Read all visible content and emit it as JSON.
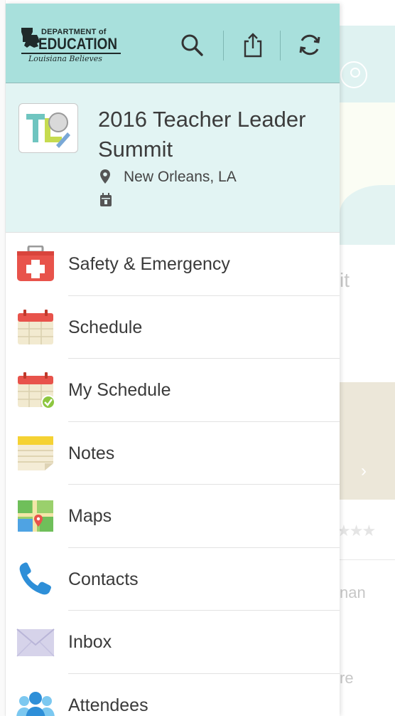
{
  "colors": {
    "header_bg": "#a8e0dc",
    "event_bg": "#e2f4f3",
    "text": "#3a3a3a",
    "icon_dark": "#333333"
  },
  "header": {
    "logo": {
      "line1": "DEPARTMENT of",
      "line2": "EDUCATION",
      "line3": "Louisiana Believes"
    },
    "actions": [
      {
        "name": "search",
        "icon": "search-icon"
      },
      {
        "name": "share",
        "icon": "share-icon"
      },
      {
        "name": "refresh",
        "icon": "refresh-icon"
      }
    ]
  },
  "event": {
    "title": "2016 Teacher Leader Summit",
    "location": "New Orleans, LA",
    "logo_text": "TL"
  },
  "menu": {
    "items": [
      {
        "label": "Safety & Emergency",
        "icon": "first-aid-kit-icon"
      },
      {
        "label": "Schedule",
        "icon": "calendar-icon"
      },
      {
        "label": "My Schedule",
        "icon": "calendar-check-icon"
      },
      {
        "label": "Notes",
        "icon": "notepad-icon"
      },
      {
        "label": "Maps",
        "icon": "map-icon"
      },
      {
        "label": "Contacts",
        "icon": "phone-icon"
      },
      {
        "label": "Inbox",
        "icon": "envelope-icon"
      },
      {
        "label": "Attendees",
        "icon": "people-icon"
      }
    ]
  },
  "background": {
    "text_fragments": [
      "it",
      "nan",
      "re"
    ]
  }
}
